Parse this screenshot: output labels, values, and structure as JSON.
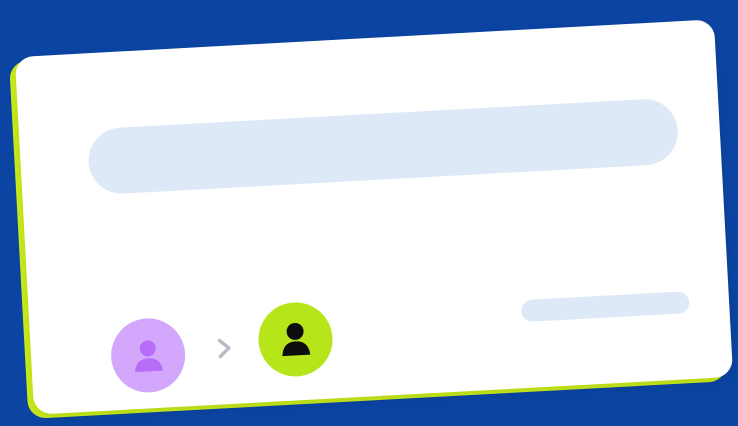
{
  "colors": {
    "background": "#0b44a2",
    "card": "#ffffff",
    "card_accent": "#c9ec1a",
    "placeholder": "#dde9f7",
    "avatar_source_bg": "#d3a7fb",
    "avatar_source_icon": "#b86df8",
    "avatar_target_bg": "#b6e61a",
    "avatar_target_icon": "#0d0d0d",
    "arrow": "#b9bcc4"
  },
  "icons": {
    "source_avatar": "person-icon",
    "target_avatar": "person-icon",
    "transition": "chevron-right-icon"
  }
}
